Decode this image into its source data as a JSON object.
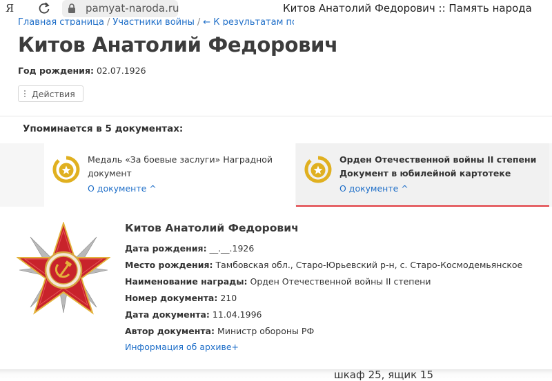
{
  "browser": {
    "logo": "Я",
    "url": "pamyat-naroda.ru",
    "tab_title": "Китов Анатолий Федорович :: Память народа"
  },
  "breadcrumb": [
    {
      "label": "Главная страница"
    },
    {
      "label": "Участники войны"
    },
    {
      "label": "← К результатам поиска"
    }
  ],
  "page": {
    "title": "Китов Анатолий Федорович",
    "birth_label": "Год рождения:",
    "birth_value": "02.07.1926",
    "actions_label": "Действия",
    "mentions_label": "Упоминается в 5 документах:"
  },
  "documents": [
    {
      "title": "Медаль «За боевые заслуги» Наградной документ",
      "link": "О документе ^",
      "icon": "medal-star-icon",
      "selected": false
    },
    {
      "title": "Орден Отечественной войны II степени Документ в юбилейной картотеке",
      "link": "О документе ^",
      "icon": "medal-star-icon",
      "selected": true
    }
  ],
  "detail": {
    "name": "Китов Анатолий Федорович",
    "fields": [
      {
        "label": "Дата рождения:",
        "value": "__.__.1926"
      },
      {
        "label": "Место рождения:",
        "value": "Тамбовская обл., Старо-Юрьевский р-н, с. Старо-Космодемьянское"
      },
      {
        "label": "Наименование награды:",
        "value": "Орден Отечественной войны II степени"
      },
      {
        "label": "Номер документа:",
        "value": "210"
      },
      {
        "label": "Дата документа:",
        "value": "11.04.1996"
      },
      {
        "label": "Автор документа:",
        "value": "Министр обороны РФ"
      }
    ],
    "archive_link": "Информация об архиве+",
    "order_image": "order-patriotic-war-image"
  },
  "bottom_text": "шкаф 25, ящик 15",
  "colors": {
    "link": "#1e6ec8",
    "accent_red": "#e0393e",
    "medal_gold": "#e0b020"
  }
}
